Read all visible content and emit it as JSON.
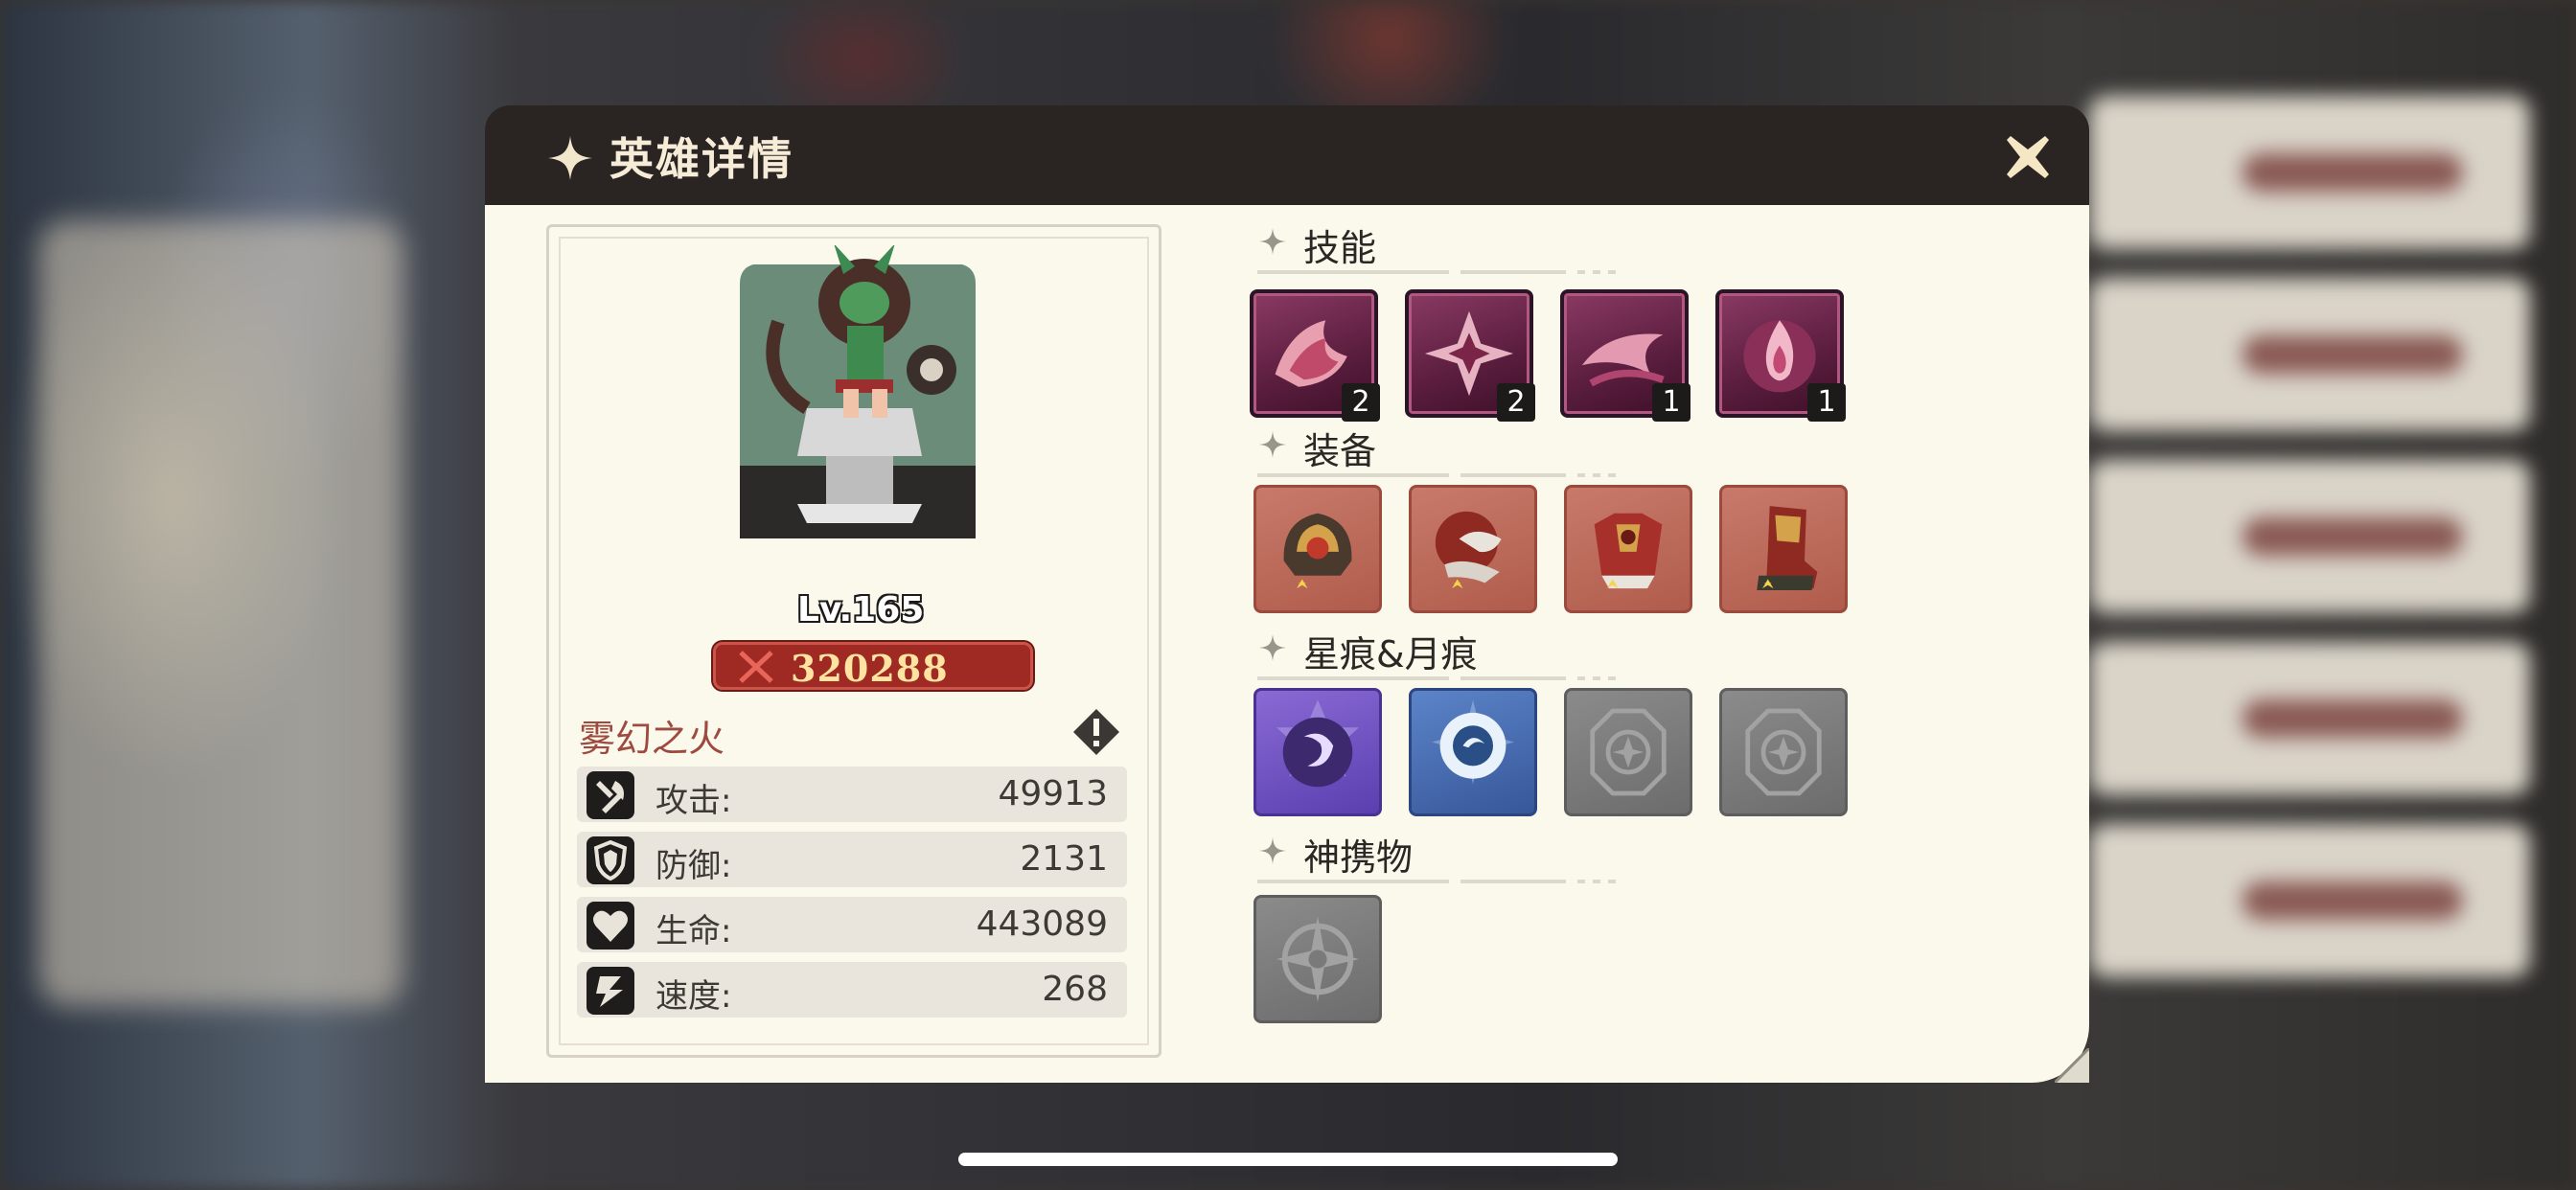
{
  "dialog": {
    "title": "英雄详情"
  },
  "hero": {
    "level": "Lv.165",
    "power": "320288",
    "name": "雾幻之火",
    "stats": [
      {
        "label": "攻击:",
        "value": "49913",
        "icon": "attack-icon"
      },
      {
        "label": "防御:",
        "value": "2131",
        "icon": "defense-icon"
      },
      {
        "label": "生命:",
        "value": "443089",
        "icon": "health-icon"
      },
      {
        "label": "速度:",
        "value": "268",
        "icon": "speed-icon"
      }
    ]
  },
  "sections": {
    "skills": {
      "title": "技能",
      "items": [
        {
          "icon": "flame-wave-skill-icon",
          "level": "2"
        },
        {
          "icon": "shuriken-skill-icon",
          "level": "2"
        },
        {
          "icon": "claw-skill-icon",
          "level": "1"
        },
        {
          "icon": "fire-orb-skill-icon",
          "level": "1"
        }
      ]
    },
    "equipment": {
      "title": "装备",
      "items": [
        {
          "icon": "helmet-equipment-icon"
        },
        {
          "icon": "gauntlet-equipment-icon"
        },
        {
          "icon": "armor-equipment-icon"
        },
        {
          "icon": "boots-equipment-icon"
        }
      ]
    },
    "marks": {
      "title": "星痕&月痕",
      "items": [
        {
          "icon": "moon-mark-icon",
          "state": "purple"
        },
        {
          "icon": "eye-mark-icon",
          "state": "blue"
        },
        {
          "icon": "empty-mark-slot-icon",
          "state": "empty"
        },
        {
          "icon": "empty-mark-slot-icon",
          "state": "empty"
        }
      ]
    },
    "artifact": {
      "title": "神携物",
      "items": [
        {
          "icon": "empty-artifact-slot-icon",
          "state": "empty"
        }
      ]
    }
  },
  "colors": {
    "header_bg": "#2a2523",
    "body_bg": "#fbf8ec",
    "power_plate": "#9e2a23",
    "hero_name": "#9e4a3e"
  }
}
